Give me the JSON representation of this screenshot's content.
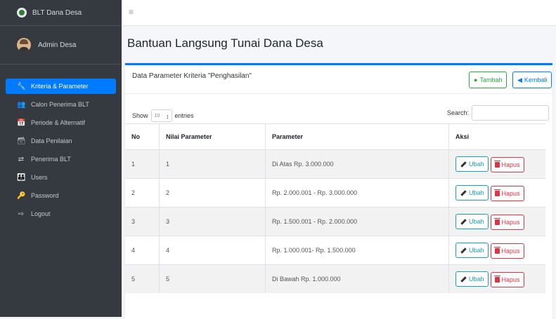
{
  "sidebar": {
    "brand": "BLT Dana Desa",
    "user": "Admin Desa",
    "items": [
      {
        "icon": "wrench-icon",
        "glyph": "🔧",
        "label": "Kriteria & Parameter"
      },
      {
        "icon": "users-icon",
        "glyph": "👥",
        "label": "Calon Penerima BLT"
      },
      {
        "icon": "calendar-icon",
        "glyph": "📅",
        "label": "Periode & Alternatif"
      },
      {
        "icon": "database-icon",
        "glyph": "🗃",
        "label": "Data Penilaian"
      },
      {
        "icon": "people-arrows-icon",
        "glyph": "⇄",
        "label": "Penerima BLT"
      },
      {
        "icon": "user-group-icon",
        "glyph": "👪",
        "label": "Users"
      },
      {
        "icon": "key-icon",
        "glyph": "🔑",
        "label": "Password"
      },
      {
        "icon": "logout-icon",
        "glyph": "⇨",
        "label": "Logout"
      }
    ]
  },
  "topbar": {
    "menu_glyph": "≡"
  },
  "page": {
    "title": "Bantuan Langsung Tunai Dana Desa"
  },
  "card": {
    "title": "Data Parameter Kriteria \"Penghasilan\"",
    "tambah": "Tambah",
    "kembali": "Kembali",
    "show_label": "Show",
    "entries_value": "10",
    "entries_label": "entries",
    "search_label": "Search:"
  },
  "table": {
    "headers": [
      "No",
      "Nilai Parameter",
      "Parameter",
      "Aksi"
    ],
    "rows": [
      {
        "no": "1",
        "nilai": "1",
        "parameter": "Di Atas Rp. 3.000.000"
      },
      {
        "no": "2",
        "nilai": "2",
        "parameter": "Rp. 2.000.001 - Rp. 3.000.000"
      },
      {
        "no": "3",
        "nilai": "3",
        "parameter": "Rp. 1.500.001 - Rp. 2.000.000"
      },
      {
        "no": "4",
        "nilai": "4",
        "parameter": "Rp. 1.000.001- Rp. 1.500.000"
      },
      {
        "no": "5",
        "nilai": "5",
        "parameter": "Di Bawah Rp. 1.000.000"
      }
    ],
    "ubah_label": "Ubah",
    "hapus_label": "Hapus"
  },
  "colors": {
    "primary": "#007bff",
    "success": "#28a745",
    "info": "#17a2b8",
    "danger": "#dc3545",
    "sidebar": "#343a40"
  }
}
